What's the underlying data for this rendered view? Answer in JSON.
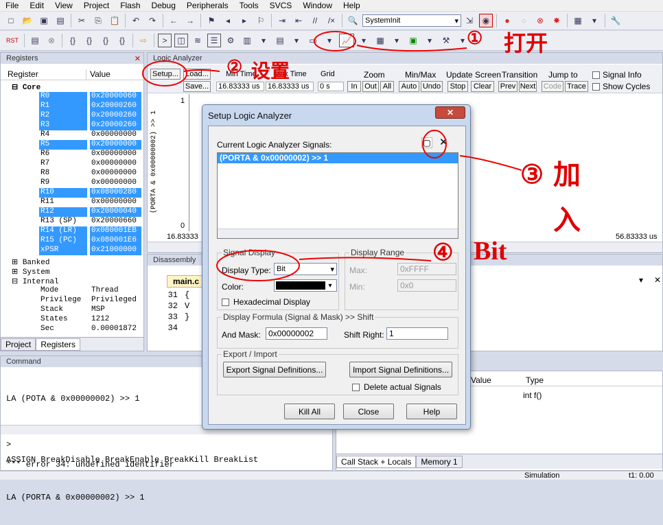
{
  "menu": [
    "File",
    "Edit",
    "View",
    "Project",
    "Flash",
    "Debug",
    "Peripherals",
    "Tools",
    "SVCS",
    "Window",
    "Help"
  ],
  "toolbar": {
    "function_combo": "SystemInit"
  },
  "registers": {
    "title": "Registers",
    "col_register": "Register",
    "col_value": "Value",
    "core_label": "Core",
    "rows": [
      {
        "name": "R0",
        "value": "0x20000060",
        "sel": true
      },
      {
        "name": "R1",
        "value": "0x20000260",
        "sel": true
      },
      {
        "name": "R2",
        "value": "0x20000260",
        "sel": true
      },
      {
        "name": "R3",
        "value": "0x20000260",
        "sel": true
      },
      {
        "name": "R4",
        "value": "0x00000000",
        "sel": false
      },
      {
        "name": "R5",
        "value": "0x20000000",
        "sel": true
      },
      {
        "name": "R6",
        "value": "0x00000000",
        "sel": false
      },
      {
        "name": "R7",
        "value": "0x00000000",
        "sel": false
      },
      {
        "name": "R8",
        "value": "0x00000000",
        "sel": false
      },
      {
        "name": "R9",
        "value": "0x00000000",
        "sel": false
      },
      {
        "name": "R10",
        "value": "0x08000280",
        "sel": true
      },
      {
        "name": "R11",
        "value": "0x00000000",
        "sel": false
      },
      {
        "name": "R12",
        "value": "0x20000040",
        "sel": true
      },
      {
        "name": "R13 (SP)",
        "value": "0x20000660",
        "sel": false
      },
      {
        "name": "R14 (LR)",
        "value": "0x080001EB",
        "sel": true
      },
      {
        "name": "R15 (PC)",
        "value": "0x080001E6",
        "sel": true
      },
      {
        "name": "xPSR",
        "value": "0x21000000",
        "sel": true
      }
    ],
    "banked": "Banked",
    "system": "System",
    "internal": "Internal",
    "internal_rows": [
      {
        "name": "Mode",
        "value": "Thread"
      },
      {
        "name": "Privilege",
        "value": "Privileged"
      },
      {
        "name": "Stack",
        "value": "MSP"
      },
      {
        "name": "States",
        "value": "1212"
      },
      {
        "name": "Sec",
        "value": "0.00001872"
      }
    ],
    "tab_project": "Project",
    "tab_registers": "Registers"
  },
  "logic": {
    "title": "Logic Analyzer",
    "setup": "Setup...",
    "load": "Load...",
    "save": "Save...",
    "min_time_label": "Min Time",
    "min_time": "16.83333 us",
    "max_time_label": "Max Time",
    "max_time": "16.83333 us",
    "grid_label": "Grid",
    "grid": "0 s",
    "zoom_label": "Zoom",
    "zoom_in": "In",
    "zoom_out": "Out",
    "zoom_all": "All",
    "minmax_label": "Min/Max",
    "auto": "Auto",
    "undo": "Undo",
    "update_label": "Update Screen",
    "stop": "Stop",
    "clear": "Clear",
    "transition_label": "Transition",
    "prev": "Prev",
    "next": "Next",
    "jump_label": "Jump to",
    "code": "Code",
    "trace": "Trace",
    "signal_info": "Signal Info",
    "show_cycles": "Show Cycles",
    "signal_name": "(PORTA & 0x00000002) >> 1",
    "y_top": "1",
    "y_bottom": "0",
    "time_left": "16.83333",
    "time_right": "56.83333 us"
  },
  "disasm": {
    "title": "Disassembly",
    "file_tab": "main.c",
    "lines": [
      {
        "n": "31",
        "t": "{"
      },
      {
        "n": "32",
        "t": "V"
      },
      {
        "n": "33",
        "t": "}"
      },
      {
        "n": "34",
        "t": ""
      }
    ]
  },
  "command": {
    "title": "Command",
    "lines": [
      "LA (POTA & 0x00000002) >> 1",
      "      ^",
      "*** error 34: undefined identifier",
      "LA (PORTA & 0x00000002) >> 1"
    ],
    "prompt": ">",
    "hint": "ASSIGN BreakDisable BreakEnable BreakKill BreakList"
  },
  "callstack": {
    "col_value": "Value",
    "col_type": "Type",
    "type_value": "int f()",
    "tab_callstack": "Call Stack + Locals",
    "tab_memory": "Memory 1"
  },
  "status": {
    "mode": "Simulation",
    "time": "t1: 0.00"
  },
  "dialog": {
    "title": "Setup Logic Analyzer",
    "signals_label": "Current Logic Analyzer Signals:",
    "signal": "(PORTA & 0x00000002) >> 1",
    "signal_display": "Signal Display",
    "display_type_label": "Display Type:",
    "display_type": "Bit",
    "color_label": "Color:",
    "hex_label": "Hexadecimal Display",
    "display_range": "Display Range",
    "max_label": "Max:",
    "max": "0xFFFF",
    "min_label": "Min:",
    "min": "0x0",
    "formula_label": "Display Formula (Signal & Mask) >> Shift",
    "and_mask_label": "And Mask:",
    "and_mask": "0x00000002",
    "shift_label": "Shift Right:",
    "shift": "1",
    "export_import": "Export / Import",
    "export_btn": "Export Signal Definitions...",
    "import_btn": "Import Signal Definitions...",
    "delete_label": "Delete actual Signals",
    "kill_all": "Kill All",
    "close": "Close",
    "help": "Help"
  },
  "annotations": {
    "a1": "①",
    "a1_text": "打开",
    "a2": "②",
    "a2_text": "设置",
    "a3": "③",
    "a3_text": "加入",
    "a4": "④",
    "a4_text": "Bit"
  },
  "colors": {
    "selection": "#3399ff",
    "annotation": "#e00000"
  }
}
